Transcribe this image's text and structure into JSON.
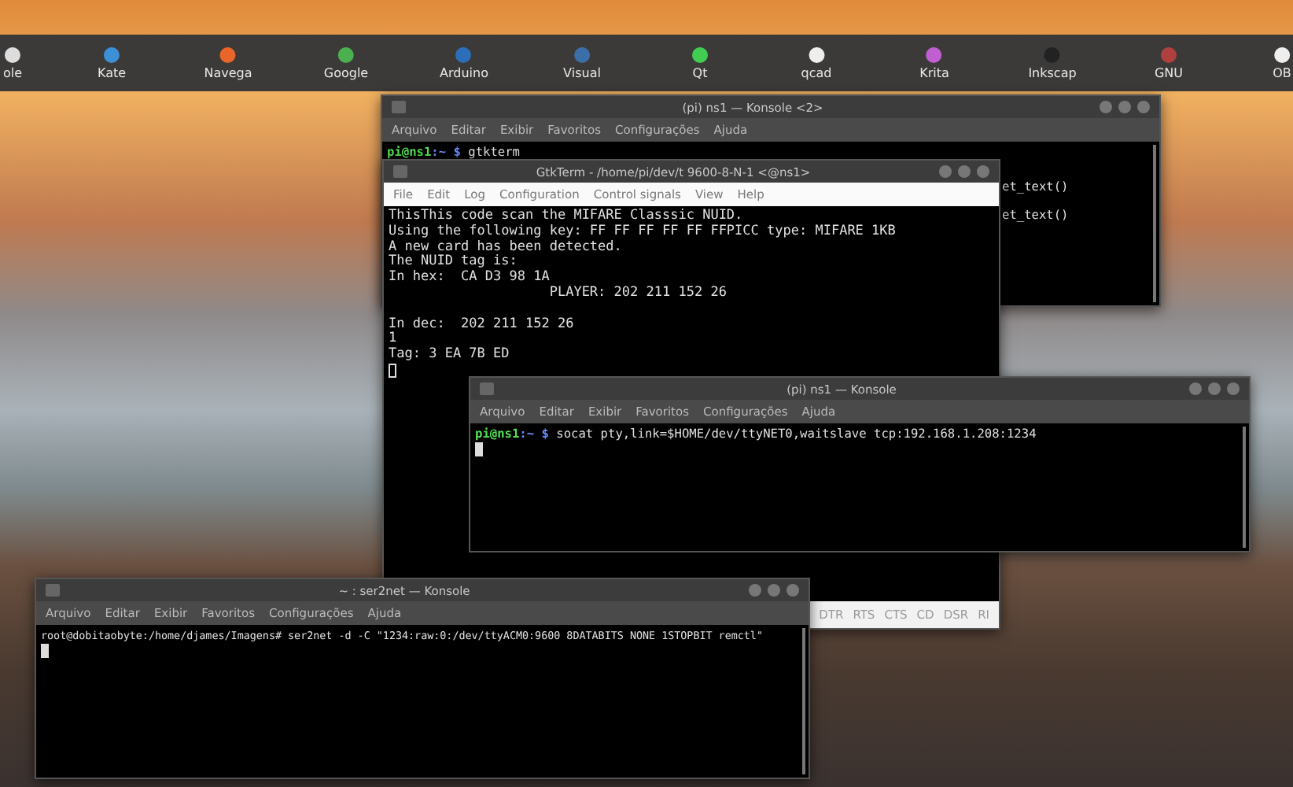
{
  "dock": {
    "items": [
      {
        "label": "ole"
      },
      {
        "label": "Kate"
      },
      {
        "label": "Navega"
      },
      {
        "label": "Google"
      },
      {
        "label": "Arduino"
      },
      {
        "label": "Visual"
      },
      {
        "label": "Qt"
      },
      {
        "label": "qcad"
      },
      {
        "label": "Krita"
      },
      {
        "label": "Inkscap"
      },
      {
        "label": "GNU"
      },
      {
        "label": "OB"
      }
    ]
  },
  "windows": [
    {
      "kind": "konsole",
      "title": "(pi) ns1 — Konsole <2>",
      "menu": [
        "Arquivo",
        "Editar",
        "Exibir",
        "Favoritos",
        "Configurações",
        "Ajuda"
      ],
      "lines": [
        {
          "user": "pi@ns1",
          "path": ":~ $",
          "text": " gtkterm"
        }
      ],
      "side_lines": [
        "et_text()",
        "et_text()"
      ]
    },
    {
      "kind": "gtkterm",
      "title": "GtkTerm - /home/pi/dev/t 9600-8-N-1 <@ns1>",
      "menu": [
        "File",
        "Edit",
        "Log",
        "Configuration",
        "Control signals",
        "View",
        "Help"
      ],
      "lines": [
        {
          "text": "ThisThis code scan the MIFARE Classsic NUID."
        },
        {
          "text": "Using the following key: FF FF FF FF FF FFPICC type: MIFARE 1KB"
        },
        {
          "text": "A new card has been detected."
        },
        {
          "text": "The NUID tag is:"
        },
        {
          "text": "In hex:  CA D3 98 1A"
        },
        {
          "text": "                    PLAYER: 202 211 152 26"
        },
        {
          "text": "In dec:  202 211 152 26",
          "blank_before": true
        },
        {
          "text": "1"
        },
        {
          "text": "Tag: 3 EA 7B ED"
        }
      ],
      "cursor": true,
      "signals": [
        "DTR",
        "RTS",
        "CTS",
        "CD",
        "DSR",
        "RI"
      ]
    },
    {
      "kind": "konsole",
      "title": "(pi) ns1 — Konsole",
      "menu": [
        "Arquivo",
        "Editar",
        "Exibir",
        "Favoritos",
        "Configurações",
        "Ajuda"
      ],
      "lines": [
        {
          "user": "pi@ns1",
          "path": ":~ $",
          "text": " socat pty,link=$HOME/dev/ttyNET0,waitslave tcp:192.168.1.208:1234"
        }
      ],
      "cursor": true
    },
    {
      "kind": "konsole",
      "title": "~ : ser2net — Konsole",
      "menu": [
        "Arquivo",
        "Editar",
        "Exibir",
        "Favoritos",
        "Configurações",
        "Ajuda"
      ],
      "lines": [
        {
          "text": "root@dobitaobyte:/home/djames/Imagens# ser2net -d -C \"1234:raw:0:/dev/ttyACM0:9600 8DATABITS NONE 1STOPBIT remctl\""
        }
      ],
      "cursor": true
    }
  ]
}
